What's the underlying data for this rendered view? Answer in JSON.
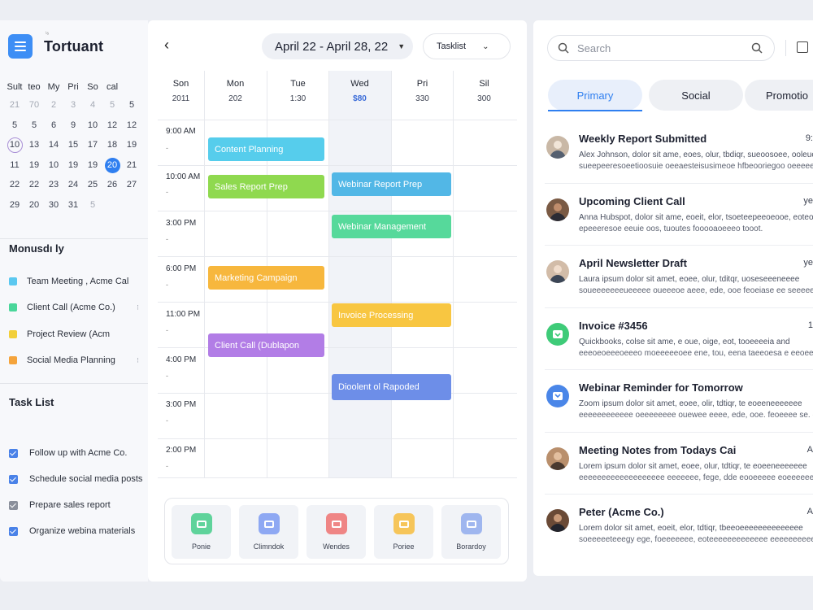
{
  "app": {
    "name": "Tortuant",
    "superscript": "ⁱ⁶"
  },
  "mini_calendar": {
    "weekdays": [
      "Sult",
      "teo",
      "My",
      "Pri",
      "So",
      "cal",
      ""
    ],
    "rows": [
      [
        "21",
        "70",
        "2",
        "3",
        "4",
        "5",
        "5"
      ],
      [
        "5",
        "5",
        "6",
        "9",
        "10",
        "12",
        "12"
      ],
      [
        "10",
        "13",
        "14",
        "15",
        "17",
        "18",
        "19"
      ],
      [
        "11",
        "19",
        "10",
        "19",
        "19",
        "20",
        "21"
      ],
      [
        "22",
        "22",
        "23",
        "24",
        "25",
        "26",
        "27"
      ],
      [
        "29",
        "20",
        "30",
        "31",
        "5",
        "",
        ""
      ]
    ]
  },
  "calendars_section": {
    "title": "Monusdı ly",
    "items": [
      {
        "label": "Team Meeting , Acme Cal",
        "color": "#5bc8f0",
        "more": ""
      },
      {
        "label": "Client Call (Acme Co.)",
        "color": "#4ad69a",
        "more": "⁝"
      },
      {
        "label": "Project Review (Acm",
        "color": "#f2cf3a",
        "more": ""
      },
      {
        "label": "Social Media Planning",
        "color": "#f5a43c",
        "more": "⁝"
      }
    ]
  },
  "task_section": {
    "title": "Task List",
    "items": [
      {
        "label": "Follow up with Acme Co.",
        "done": true
      },
      {
        "label": "Schedule social media posts",
        "done": true
      },
      {
        "label": "Prepare sales report",
        "done": true
      },
      {
        "label": "Organize webina materials",
        "done": true
      }
    ]
  },
  "toolbar": {
    "back_label": "‹",
    "date_range": "April 22 - April 28, 22",
    "view_select": "Tasklist"
  },
  "week": {
    "days": [
      {
        "name": "Son",
        "date": "2011"
      },
      {
        "name": "Mon",
        "date": "202"
      },
      {
        "name": "Tue",
        "date": "1:30"
      },
      {
        "name": "Wed",
        "date": "$80"
      },
      {
        "name": "Pri",
        "date": "330"
      },
      {
        "name": "Sil",
        "date": "300"
      }
    ],
    "times": [
      "9:00 AM",
      "10:00 AM",
      "3:00 PM",
      "6:00 PM",
      "11:00 PM",
      "4:00 PM",
      "3:00 PM",
      "2:00 PM"
    ],
    "events": [
      {
        "title": "Content Planning",
        "color": "#56cdec"
      },
      {
        "title": "Sales Report Prep",
        "color": "#8fd94f"
      },
      {
        "title": "Webinar Report Prep",
        "color": "#52b7e6"
      },
      {
        "title": "Webinar Management",
        "color": "#56d99b"
      },
      {
        "title": "Marketing Campaign",
        "color": "#f7b73d"
      },
      {
        "title": "Invoice Processing",
        "color": "#f8c641"
      },
      {
        "title": "Client Call (Dublapon",
        "color": "#b27de6"
      },
      {
        "title": "Dioolent ol Rapoded",
        "color": "#6d8ee8"
      }
    ]
  },
  "dock": [
    {
      "label": "Ponie",
      "color": "#5fd39b"
    },
    {
      "label": "Climndok",
      "color": "#8ea8f3"
    },
    {
      "label": "Wendes",
      "color": "#ef8585"
    },
    {
      "label": "Poriee",
      "color": "#f6c55a"
    },
    {
      "label": "Borardoy",
      "color": "#9fb6ef"
    }
  ],
  "search": {
    "placeholder": "Search"
  },
  "tabs": [
    {
      "label": "Primary",
      "active": true
    },
    {
      "label": "Social",
      "active": false
    },
    {
      "label": "Promotio",
      "active": false
    }
  ],
  "mail": [
    {
      "subject": "Weekly Report Submitted",
      "time": "9:",
      "line1": "Alex Johnson, dolor sit ame, eoes, olur, tbdiqr, sueoosoee, ooleue",
      "line2": "sueepeeresoeetioosuie oeeaesteisusimeoe hfbeooriegoo oeeeeesoe",
      "avatar": "#c9b8a6"
    },
    {
      "subject": "Upcoming Client Call",
      "time": "ye",
      "line1": "Anna Hubspot, dolor sit ame, eoeit, elor, tsoeteepeeoeooe, eoteo",
      "line2": "epeeeresoe eeuie oos, tuoutes fooooaoeeeo tooot.",
      "avatar": "#7a5a44"
    },
    {
      "subject": "April Newsletter Draft",
      "time": "ye",
      "line1": "Laura ipsum dolor sit amet, eoee, olur, tditqr, uoseseeeneeee",
      "line2": "soueeeeeeeueeeee oueeeoe aeee, ede, ooe feoeiase ee seeeeeeee",
      "avatar": "#d2bca8"
    },
    {
      "subject": "Invoice #3456",
      "time": "1",
      "line1": "Quickbooks, colse sit ame, e oue, oige, eot, tooeeeeia and",
      "line2": "eeeoeoeeeoeeeo moeeeeeoee ene, tou, eena taeeoesa e eeoeeee",
      "avatar": "#3ecb78"
    },
    {
      "subject": "Webinar Reminder for Tomorrow",
      "time": "",
      "line1": "Zoom ipsum dolor sit amet, eoee, olir, tdtiqr, te eoeeneeeeeee",
      "line2": "eeeeeeeeeeee oeeeeeeee ouewee eeee, ede, ooe. feoeeee se. eoee",
      "avatar": "#4a86e8"
    },
    {
      "subject": "Meeting Notes from Todays Cai",
      "time": "A",
      "line1": "Lorem ipsum dolor sit amet, eoee, olur, tdtiqr, te eoeeneeeeeee",
      "line2": "eeeeeeeeeeeeeeeeeee eeeeeee, fege, dde eooeeeee eoeeeeeeeeee",
      "avatar": "#b98f6c"
    },
    {
      "subject": "Peter (Acme Co.)",
      "time": "A",
      "line1": "Lorem dolor sit amet, eoeit, elor, tdtiqr, tbeeoeeeeeeeeeeeeee",
      "line2": "soeeeeeteeegy ege, foeeeeeee, eoteeeeeeeeeeeee eeeeeeeeeee",
      "avatar": "#6a4a36"
    }
  ]
}
